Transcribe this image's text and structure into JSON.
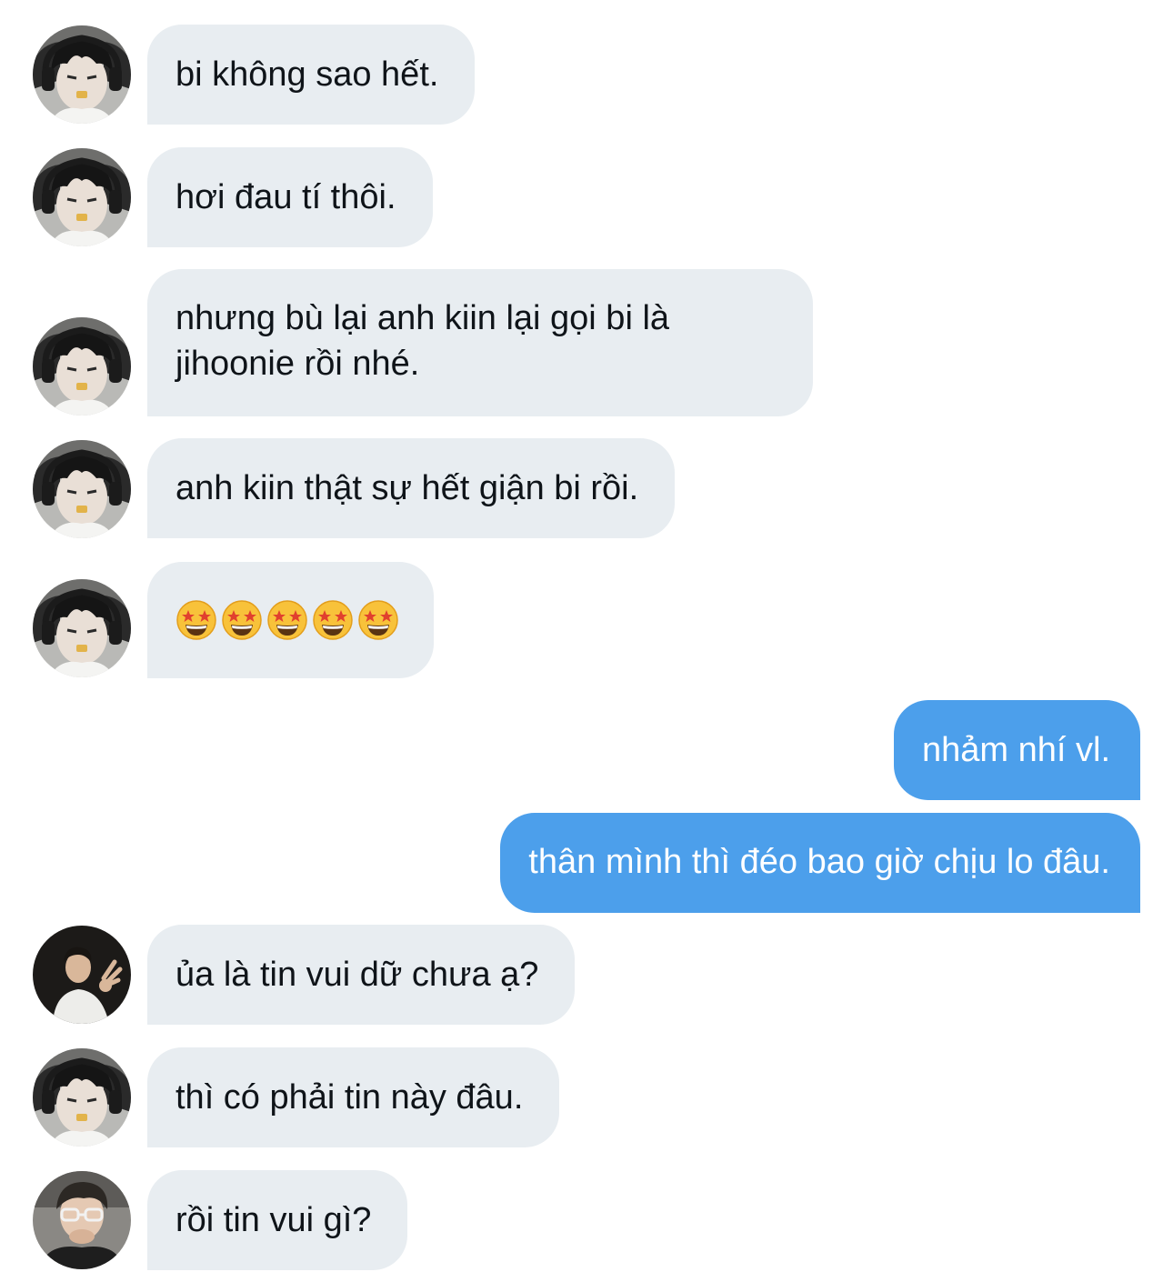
{
  "messages": [
    {
      "side": "in",
      "avatar": "avatar-bi",
      "text": "bi không sao hết."
    },
    {
      "side": "in",
      "avatar": "avatar-bi",
      "text": "hơi đau tí thôi."
    },
    {
      "side": "in",
      "avatar": "avatar-bi",
      "lines": [
        "nhưng bù lại anh kiin lại gọi bi là",
        "jihoonie rồi nhé."
      ]
    },
    {
      "side": "in",
      "avatar": "avatar-bi",
      "text": "anh kiin thật sự hết giận bi rồi."
    },
    {
      "side": "in",
      "avatar": "avatar-bi",
      "emoji": [
        "star-struck-emoji",
        "star-struck-emoji",
        "star-struck-emoji",
        "star-struck-emoji",
        "star-struck-emoji"
      ]
    },
    {
      "side": "out",
      "text": "nhảm nhí vl."
    },
    {
      "side": "out",
      "text": "thân mình thì đéo bao giờ chịu lo đâu."
    },
    {
      "side": "in",
      "avatar": "avatar-guy-dark",
      "text": "ủa là tin vui dữ chưa ạ?"
    },
    {
      "side": "in",
      "avatar": "avatar-bi",
      "text": "thì có phải tin này đâu."
    },
    {
      "side": "in",
      "avatar": "avatar-guy-glasses",
      "text": "rồi tin vui gì?"
    }
  ],
  "colors": {
    "incoming_bubble": "#e8edf1",
    "outgoing_bubble": "#4c9feb",
    "incoming_text": "#0f1419",
    "outgoing_text": "#ffffff"
  }
}
